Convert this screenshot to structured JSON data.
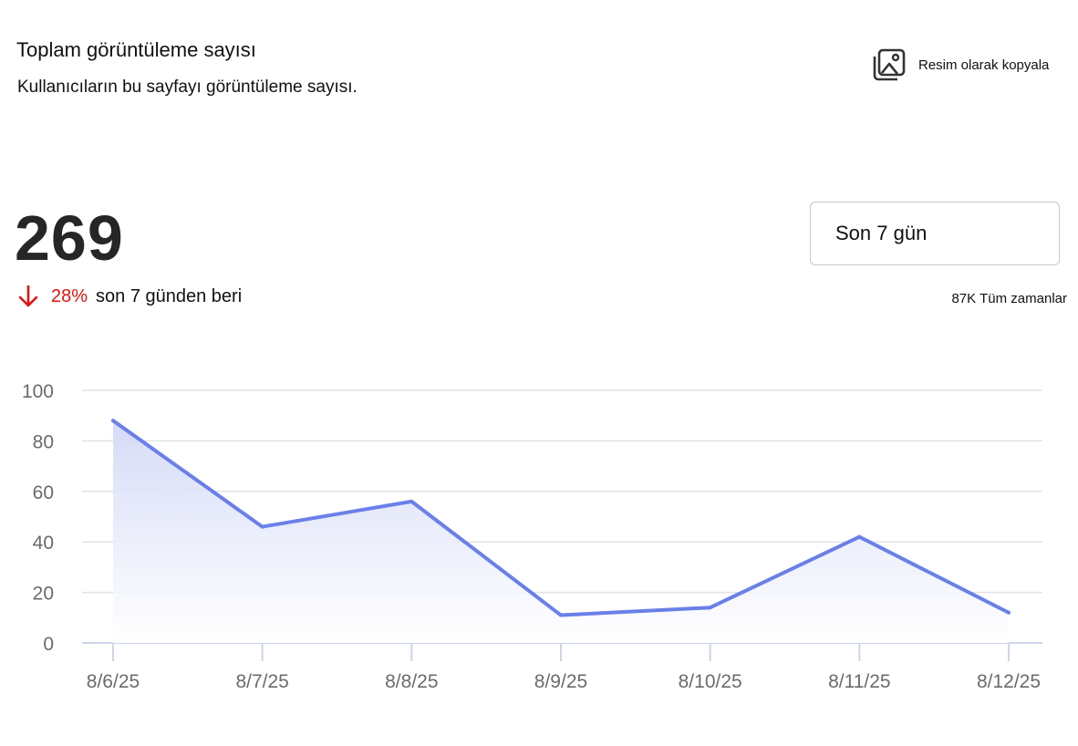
{
  "header": {
    "title": "Toplam görüntüleme sayısı",
    "subtitle": "Kullanıcıların bu sayfayı görüntüleme sayısı.",
    "copy_label": "Resim olarak kopyala"
  },
  "summary": {
    "value": "269",
    "change_percent": "28%",
    "change_direction": "down",
    "change_text": "son 7 günden beri",
    "change_color": "#e0140f"
  },
  "range": {
    "selected": "Son 7 gün",
    "all_time_value": "87K",
    "all_time_label": "Tüm zamanlar"
  },
  "chart_data": {
    "type": "area",
    "categories": [
      "8/6/25",
      "8/7/25",
      "8/8/25",
      "8/9/25",
      "8/10/25",
      "8/11/25",
      "8/12/25"
    ],
    "values": [
      88,
      46,
      56,
      11,
      14,
      42,
      12
    ],
    "ylim": [
      0,
      100
    ],
    "yticks": [
      0,
      20,
      40,
      60,
      80,
      100
    ],
    "grid": true,
    "line_color": "#6a7fe8",
    "fill_color": "#dfe3f8"
  }
}
